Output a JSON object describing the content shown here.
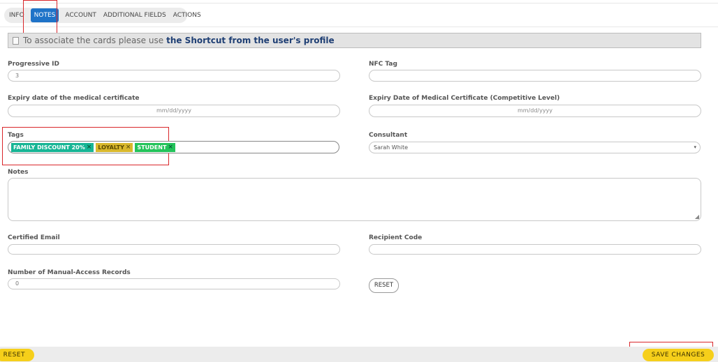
{
  "tabs": [
    {
      "label": "INFO",
      "active": false
    },
    {
      "label": "NOTES",
      "active": true
    },
    {
      "label": "ACCOUNT",
      "active": false
    },
    {
      "label": "ADDITIONAL FIELDS",
      "active": false
    },
    {
      "label": "ACTIONS",
      "active": false
    }
  ],
  "notice": {
    "text": "To associate the cards please use",
    "link": "the Shortcut from the user's profile"
  },
  "form": {
    "progressive_id": {
      "label": "Progressive ID",
      "value": "3"
    },
    "nfc_tag": {
      "label": "NFC Tag",
      "value": ""
    },
    "medical_expiry": {
      "label": "Expiry date of the medical certificate",
      "placeholder": "mm/dd/yyyy"
    },
    "medical_expiry_competitive": {
      "label": "Expiry Date of Medical Certificate (Competitive Level)",
      "placeholder": "mm/dd/yyyy"
    },
    "tags": {
      "label": "Tags",
      "items": [
        {
          "text": "FAMILY DISCOUNT 20%",
          "color": "#17b595"
        },
        {
          "text": "LOYALTY",
          "color": "#d9b82c"
        },
        {
          "text": "STUDENT",
          "color": "#23c35a"
        }
      ]
    },
    "consultant": {
      "label": "Consultant",
      "value": "Sarah White"
    },
    "notes": {
      "label": "Notes",
      "value": ""
    },
    "certified_email": {
      "label": "Certified Email",
      "value": ""
    },
    "recipient_code": {
      "label": "Recipient Code",
      "value": ""
    },
    "manual_access": {
      "label": "Number of Manual-Access Records",
      "value": "0"
    },
    "reset_button": "RESET"
  },
  "footer": {
    "reset": "RESET",
    "save": "SAVE CHANGES"
  },
  "colors": {
    "accent": "#1f73c8",
    "save_button": "#f6cf1a",
    "highlight": "#d9262a"
  },
  "icons": {
    "tag_remove": "×",
    "dropdown": "▾",
    "resize_handle": "◢"
  }
}
